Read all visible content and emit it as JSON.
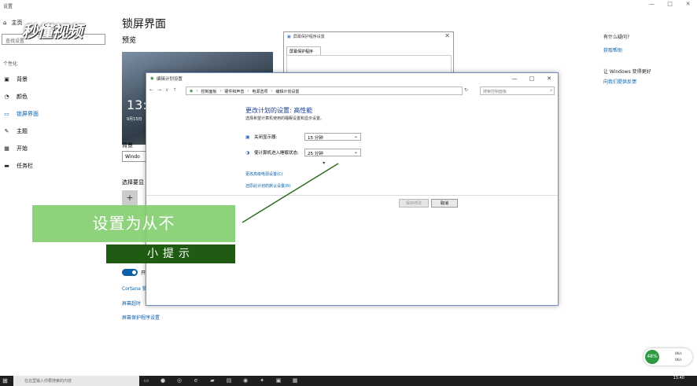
{
  "settings": {
    "titlebar": "设置",
    "win_controls": [
      "—",
      "□",
      "✕"
    ],
    "home": "主页",
    "search_placeholder": "查找设置",
    "category": "个性化",
    "nav": [
      "背景",
      "颜色",
      "锁屏界面",
      "主题",
      "开始",
      "任务栏"
    ],
    "selected_nav": "锁屏界面",
    "page_title": "锁屏界面",
    "preview_label": "预览",
    "preview_time": "13:",
    "preview_date": "9月15日",
    "background_label": "背景",
    "background_value": "Windo",
    "apps_label": "选择要显",
    "plus": "+",
    "toggle_text": "开",
    "link_cortana": "Cortana 锁",
    "link_timeout": "屏幕超时",
    "link_screensaver": "屏幕保护程序设置"
  },
  "help": {
    "question": "有什么疑问?",
    "get_help": "获取帮助",
    "improve": "让 Windows 变得更好",
    "feedback": "向我们提供反馈"
  },
  "screensaver_dialog": {
    "title": "屏幕保护程序设置",
    "tab": "屏幕保护程序",
    "close": "✕"
  },
  "edit_plan": {
    "title": "编辑计划设置",
    "win_controls": [
      "—",
      "□",
      "✕"
    ],
    "nav_arrows": [
      "←",
      "→",
      "∨",
      "↑"
    ],
    "breadcrumb": [
      "控制面板",
      "硬件和声音",
      "电源选项",
      "编辑计划设置"
    ],
    "refresh": "↻",
    "search_placeholder": "搜索控制面板",
    "heading": "更改计划的设置: 高性能",
    "subtitle": "选择希望计算机使用的睡眠设置和显示设置。",
    "display_label": "关闭显示器:",
    "display_value": "15 分钟",
    "sleep_label": "使计算机进入睡眠状态:",
    "sleep_value": "25 分钟",
    "advanced_link": "更改高级电源设置(C)",
    "restore_link": "还原此计划的默认设置(R)",
    "save": "保存修改",
    "cancel": "取消"
  },
  "overlay": {
    "tip_main": "设置为从不",
    "tip_label": "小提示",
    "watermark": "秒懂视频"
  },
  "network": {
    "percent": "48%",
    "up": "0K/s",
    "down": "0K/s"
  },
  "taskbar": {
    "search": "在这里输入你要搜索的内容",
    "time": "13:40"
  }
}
